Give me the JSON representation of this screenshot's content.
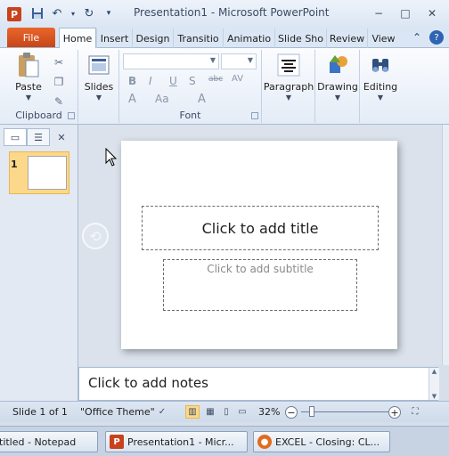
{
  "window": {
    "title": "Presentation1  -  Microsoft PowerPoint",
    "app_icon": "P"
  },
  "qat": {
    "icons": [
      "save-icon",
      "undo-icon",
      "redo-icon",
      "customize-icon"
    ]
  },
  "window_controls": {
    "minimize": "−",
    "maximize": "□",
    "close": "✕"
  },
  "tabs": {
    "file": "File",
    "items": [
      "Home",
      "Insert",
      "Design",
      "Transitio",
      "Animatio",
      "Slide Sho",
      "Review",
      "View"
    ],
    "active": "Home"
  },
  "ribbon": {
    "clipboard": {
      "label": "Clipboard",
      "paste": "Paste"
    },
    "slides": {
      "new_slide": "Slides"
    },
    "font": {
      "label": "Font",
      "bold": "B",
      "italic": "I",
      "underline": "U",
      "strike": "S",
      "size_up": "A",
      "aa": "Aa",
      "spacing": "AV",
      "clear": "A"
    },
    "paragraph": {
      "label": "Paragraph"
    },
    "drawing": {
      "label": "Drawing"
    },
    "editing": {
      "label": "Editing"
    }
  },
  "slides_pane": {
    "slide_number": "1"
  },
  "slide": {
    "title_placeholder": "Click to add title",
    "subtitle_placeholder": "Click to add subtitle"
  },
  "notes": {
    "placeholder": "Click to add notes"
  },
  "status": {
    "slide_info": "Slide 1 of 1",
    "theme": "\"Office Theme\"",
    "zoom": "32%",
    "zoom_level_percent": 32
  },
  "taskbar": {
    "items": [
      {
        "label": "titled - Notepad",
        "icon": "notepad-icon"
      },
      {
        "label": "Presentation1 - Micr...",
        "icon": "powerpoint-icon"
      },
      {
        "label": "EXCEL - Closing: CL...",
        "icon": "firefox-icon"
      }
    ]
  },
  "colors": {
    "file_tab": "#d0521e",
    "accent_selected": "#fbd88a",
    "ribbon_bg": "#e4ecf7"
  }
}
